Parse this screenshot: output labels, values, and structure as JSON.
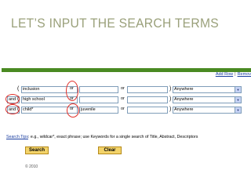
{
  "slide": {
    "title": "LET’S INPUT THE SEARCH TERMS"
  },
  "top_links": {
    "add_row": "Add Row",
    "separator": "|",
    "remove": "Remov"
  },
  "rows": [
    {
      "op": "",
      "term1": "inclusion",
      "bool1": "or",
      "term2": "",
      "bool2": "or",
      "term3": "",
      "field": "Anywhere"
    },
    {
      "op": "and",
      "term1": "high school",
      "bool1": "or",
      "term2": "",
      "bool2": "or",
      "term3": "",
      "field": "Anywhere"
    },
    {
      "op": "and",
      "term1": "child*",
      "bool1": "or",
      "term2": "juvenile",
      "bool2": "or",
      "term3": "",
      "field": "Anywhere"
    }
  ],
  "tips": {
    "link": "Search Tips",
    "text": ": e.g., wildcar*, exact phrase; use Keywords for a single search of Title, Abstract, Descriptors"
  },
  "buttons": {
    "search": "Search",
    "clear": "Clear"
  },
  "footer": {
    "partial": "© 2010"
  },
  "colors": {
    "top_bar": "#4a8a22",
    "button": "#f3d36a",
    "annotation": "#e0302a",
    "link": "#1a3ea0"
  }
}
